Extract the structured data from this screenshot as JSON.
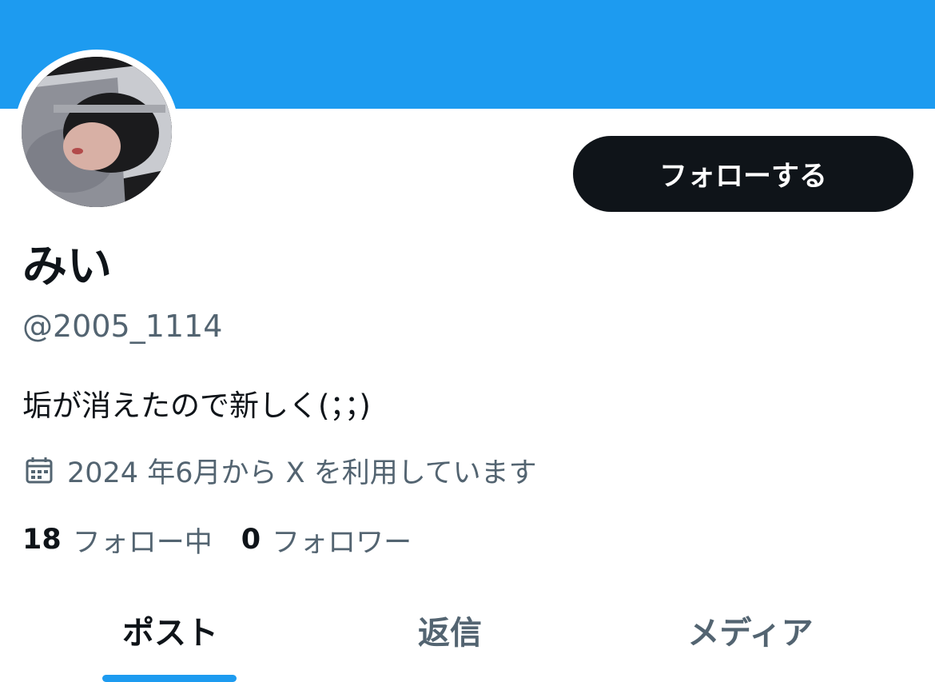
{
  "profile": {
    "display_name": "みい",
    "handle": "@2005_1114",
    "bio": "垢が消えたので新しく(；；)",
    "joined": "2024 年6月から X を利用しています"
  },
  "actions": {
    "follow_label": "フォローする"
  },
  "stats": {
    "following_count": "18",
    "following_label": "フォロー中",
    "followers_count": "0",
    "followers_label": "フォロワー"
  },
  "tabs": [
    {
      "label": "ポスト",
      "active": true
    },
    {
      "label": "返信",
      "active": false
    },
    {
      "label": "メディア",
      "active": false
    }
  ],
  "colors": {
    "banner": "#1d9bf0",
    "accent": "#1d9bf0",
    "button_bg": "#0f1419",
    "text_primary": "#0f1419",
    "text_secondary": "#536471"
  },
  "icons": {
    "joined": "calendar-icon"
  }
}
